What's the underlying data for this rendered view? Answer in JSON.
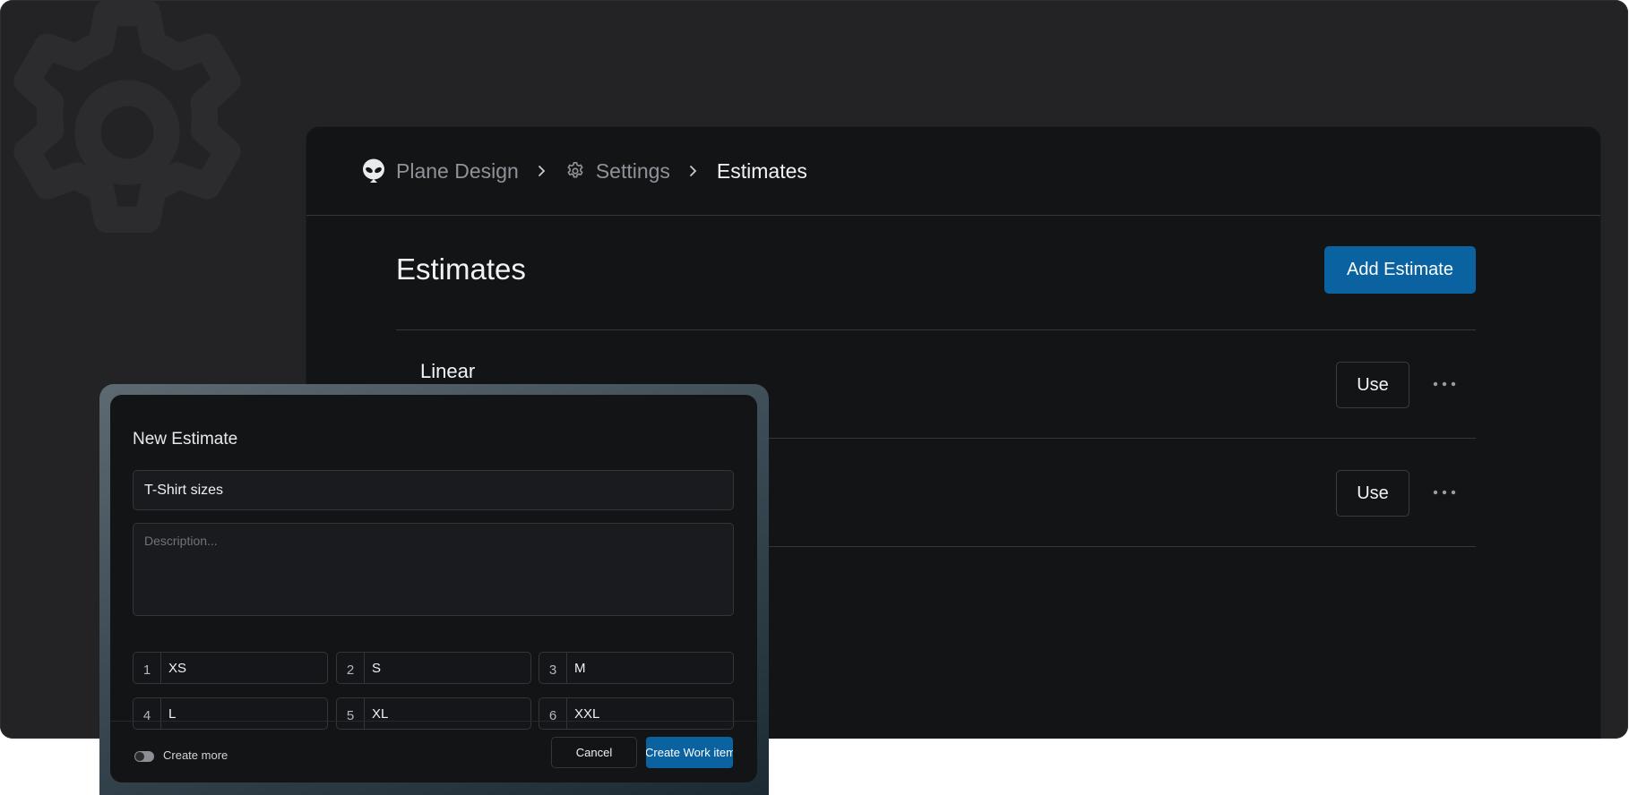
{
  "breadcrumb": {
    "workspace": "Plane Design",
    "settings": "Settings",
    "current": "Estimates"
  },
  "page": {
    "title": "Estimates",
    "add_button": "Add Estimate"
  },
  "estimates": [
    {
      "name": "Linear",
      "use_label": "Use"
    },
    {
      "name": "",
      "use_label": "Use"
    }
  ],
  "modal": {
    "title": "New Estimate",
    "name_value": "T-Shirt sizes",
    "description_placeholder": "Description...",
    "points": [
      {
        "num": "1",
        "value": "XS"
      },
      {
        "num": "2",
        "value": "S"
      },
      {
        "num": "3",
        "value": "M"
      },
      {
        "num": "4",
        "value": "L"
      },
      {
        "num": "5",
        "value": "XL"
      },
      {
        "num": "6",
        "value": "XXL"
      }
    ],
    "create_more_label": "Create more",
    "cancel_label": "Cancel",
    "create_label": "Create Work item"
  },
  "icons": {
    "workspace": "alien-icon",
    "settings": "gear-icon",
    "separator": "chevron-right-icon",
    "more": "ellipsis-icon",
    "background": "gear-icon"
  },
  "colors": {
    "accent": "#0a62a0",
    "panel": "#131416",
    "frame": "#232325"
  }
}
